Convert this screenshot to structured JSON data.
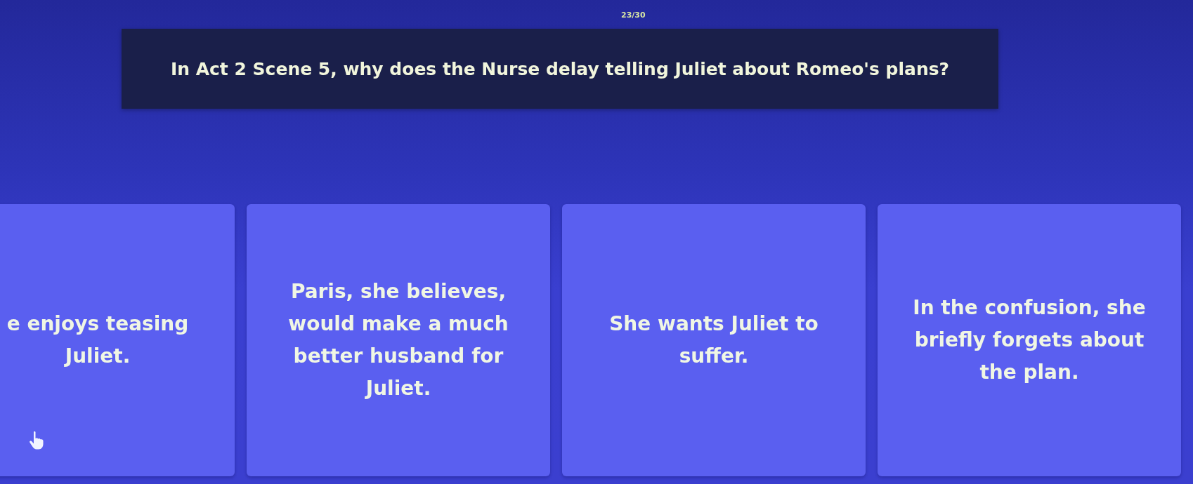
{
  "progress": {
    "counter": "23/30"
  },
  "question": {
    "text": "In Act 2 Scene 5, why does the Nurse delay telling Juliet about Romeo's plans?"
  },
  "answers": [
    {
      "text": "e enjoys teasing Juliet."
    },
    {
      "text": "Paris, she believes, would make a much better husband for Juliet."
    },
    {
      "text": "She wants Juliet to suffer."
    },
    {
      "text": "In the confusion, she briefly forgets about the plan."
    }
  ]
}
